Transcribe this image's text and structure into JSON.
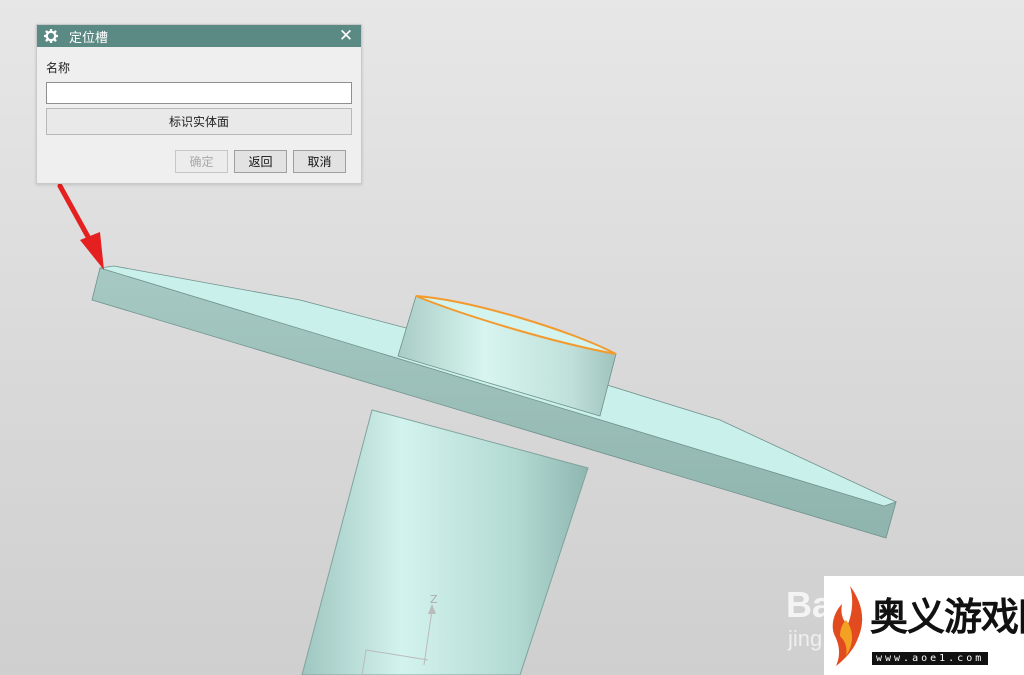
{
  "dialog": {
    "title": "定位槽",
    "name_label": "名称",
    "name_value": "",
    "select_face_label": "标识实体面",
    "ok_label": "确定",
    "back_label": "返回",
    "cancel_label": "取消"
  },
  "viewport": {
    "axis_label": "Z",
    "model_color": "#bfe6df",
    "highlight_color": "#f39a2e",
    "arrow_color": "#e52020"
  },
  "watermark": {
    "baidu_text": "Ba",
    "baidu_sub": "jing",
    "logo_text": "奥义游戏网",
    "logo_url": "www.aoe1.com"
  }
}
